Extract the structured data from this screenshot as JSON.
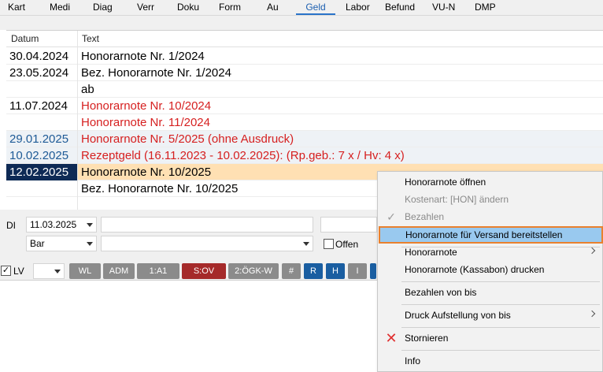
{
  "tabs": [
    "Kart",
    "Medi",
    "Diag",
    "Verr",
    "Doku",
    "Form",
    "Au",
    "Geld",
    "Labor",
    "Befund",
    "VU-N",
    "DMP"
  ],
  "active_tab": "Geld",
  "grid": {
    "headers": {
      "date": "Datum",
      "text": "Text"
    },
    "rows": [
      {
        "date": "30.04.2024",
        "text": "Honorarnote Nr. 1/2024"
      },
      {
        "date": "23.05.2024",
        "text": "Bez. Honorarnote Nr. 1/2024"
      },
      {
        "date": "",
        "text": "ab"
      },
      {
        "date": "11.07.2024",
        "text": "Honorarnote Nr. 10/2024"
      },
      {
        "date": "",
        "text": "Honorarnote Nr. 11/2024"
      },
      {
        "date": "29.01.2025",
        "text": "Honorarnote Nr. 5/2025 (ohne Ausdruck)"
      },
      {
        "date": "10.02.2025",
        "text": "Rezeptgeld (16.11.2023 - 10.02.2025): (Rp.geb.: 7 x / Hv: 4 x)"
      },
      {
        "date": "12.02.2025",
        "text": "Honorarnote Nr. 10/2025"
      },
      {
        "date": "",
        "text": "Bez. Honorarnote Nr. 10/2025"
      }
    ]
  },
  "form": {
    "day_label": "DI",
    "date_value": "11.03.2025",
    "payment_value": "Bar",
    "offen_label": "Offen"
  },
  "toolbar": {
    "lv_label": "LV",
    "buttons": [
      "WL",
      "ADM",
      "1:A1",
      "S:OV",
      "2:ÖGK-W",
      "#",
      "R",
      "H",
      "I"
    ]
  },
  "context_menu": {
    "items": [
      "Honorarnote öffnen",
      "Kostenart: [HON] ändern",
      "Bezahlen",
      "Honorarnote für Versand bereitstellen",
      "Honorarnote",
      "Honorarnote (Kassabon) drucken",
      "Bezahlen von bis",
      "Druck Aufstellung von bis",
      "Stornieren",
      "Info"
    ]
  },
  "colors": {
    "accent_tab": "#1c5fb0",
    "red_text": "#d62020",
    "blue_text": "#1e5a96",
    "selected_row": "#ffe0b3",
    "menu_highlight": "#99c9ef",
    "menu_highlight_border": "#e9812e"
  },
  "icons": {
    "check": "check-icon",
    "cross": "cross-icon"
  }
}
